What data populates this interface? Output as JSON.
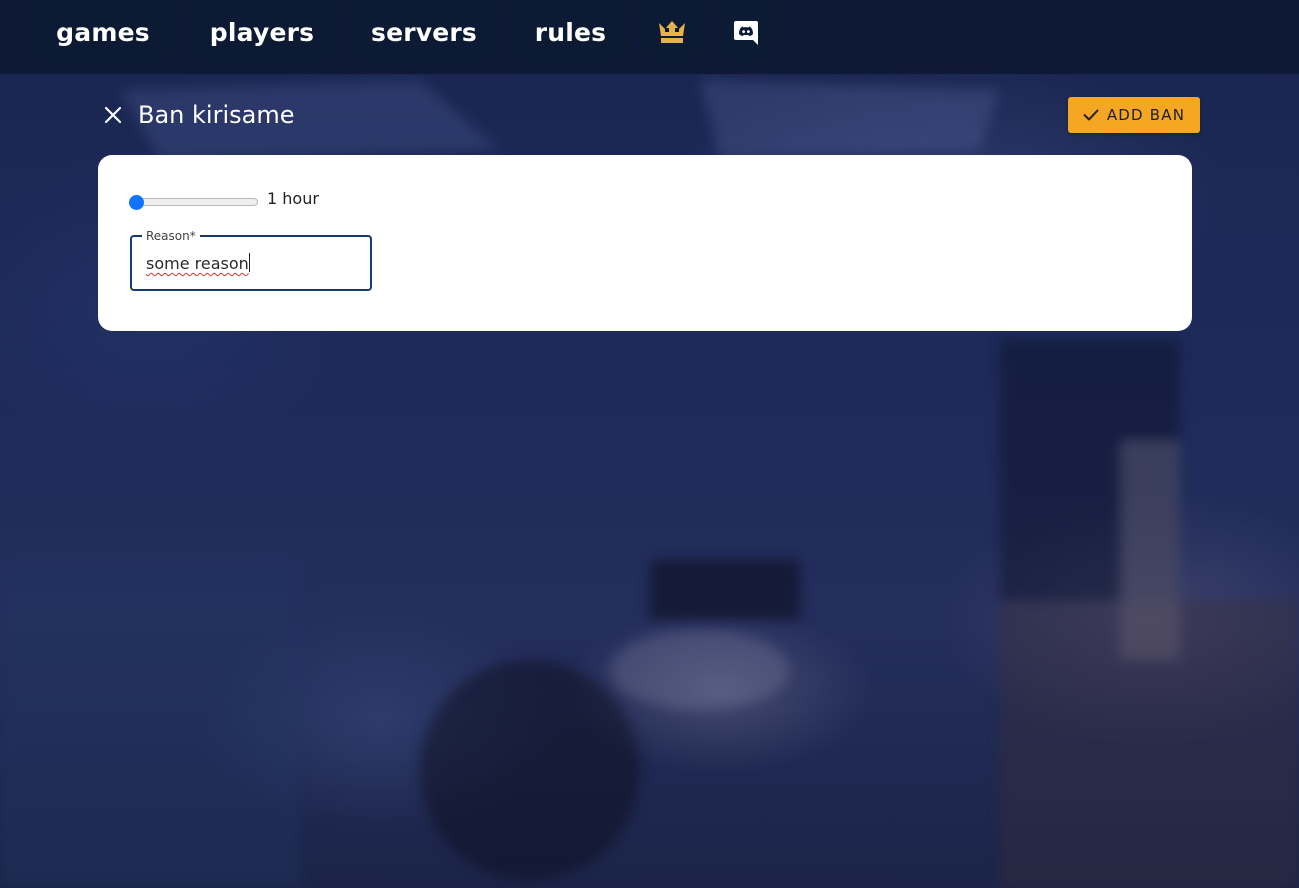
{
  "nav": {
    "items": [
      {
        "label": "games"
      },
      {
        "label": "players"
      },
      {
        "label": "servers"
      },
      {
        "label": "rules"
      }
    ],
    "crown_icon": "crown-icon",
    "discord_icon": "discord-icon",
    "icon_color": "#e3b34d"
  },
  "ban": {
    "title": "Ban kirisame",
    "add_label": "ADD BAN",
    "duration": {
      "value_label": "1 hour",
      "level": 0
    },
    "reason": {
      "label": "Reason",
      "required_mark": "*",
      "value": "some reason"
    }
  },
  "colors": {
    "accent": "#f5a623",
    "slider": "#1173ff",
    "field_border": "#1a3a6d"
  }
}
